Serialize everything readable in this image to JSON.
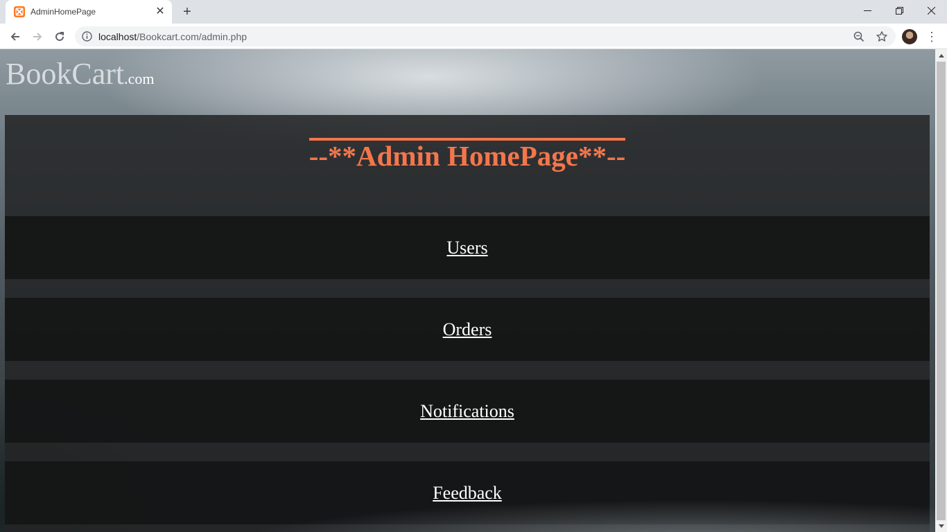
{
  "browser": {
    "tab_title": "AdminHomePage",
    "tab_icon": "xampp-icon",
    "new_tab_label": "+",
    "url_host": "localhost",
    "url_path": "/Bookcart.com/admin.php"
  },
  "page": {
    "logo_main": "BookCart",
    "logo_suffix": ".com",
    "heading": "--**Admin HomePage**--",
    "links": [
      {
        "label": "Users"
      },
      {
        "label": "Orders"
      },
      {
        "label": "Notifications"
      },
      {
        "label": "Feedback"
      }
    ]
  },
  "colors": {
    "heading": "#f4764b",
    "link": "#ffffff"
  }
}
